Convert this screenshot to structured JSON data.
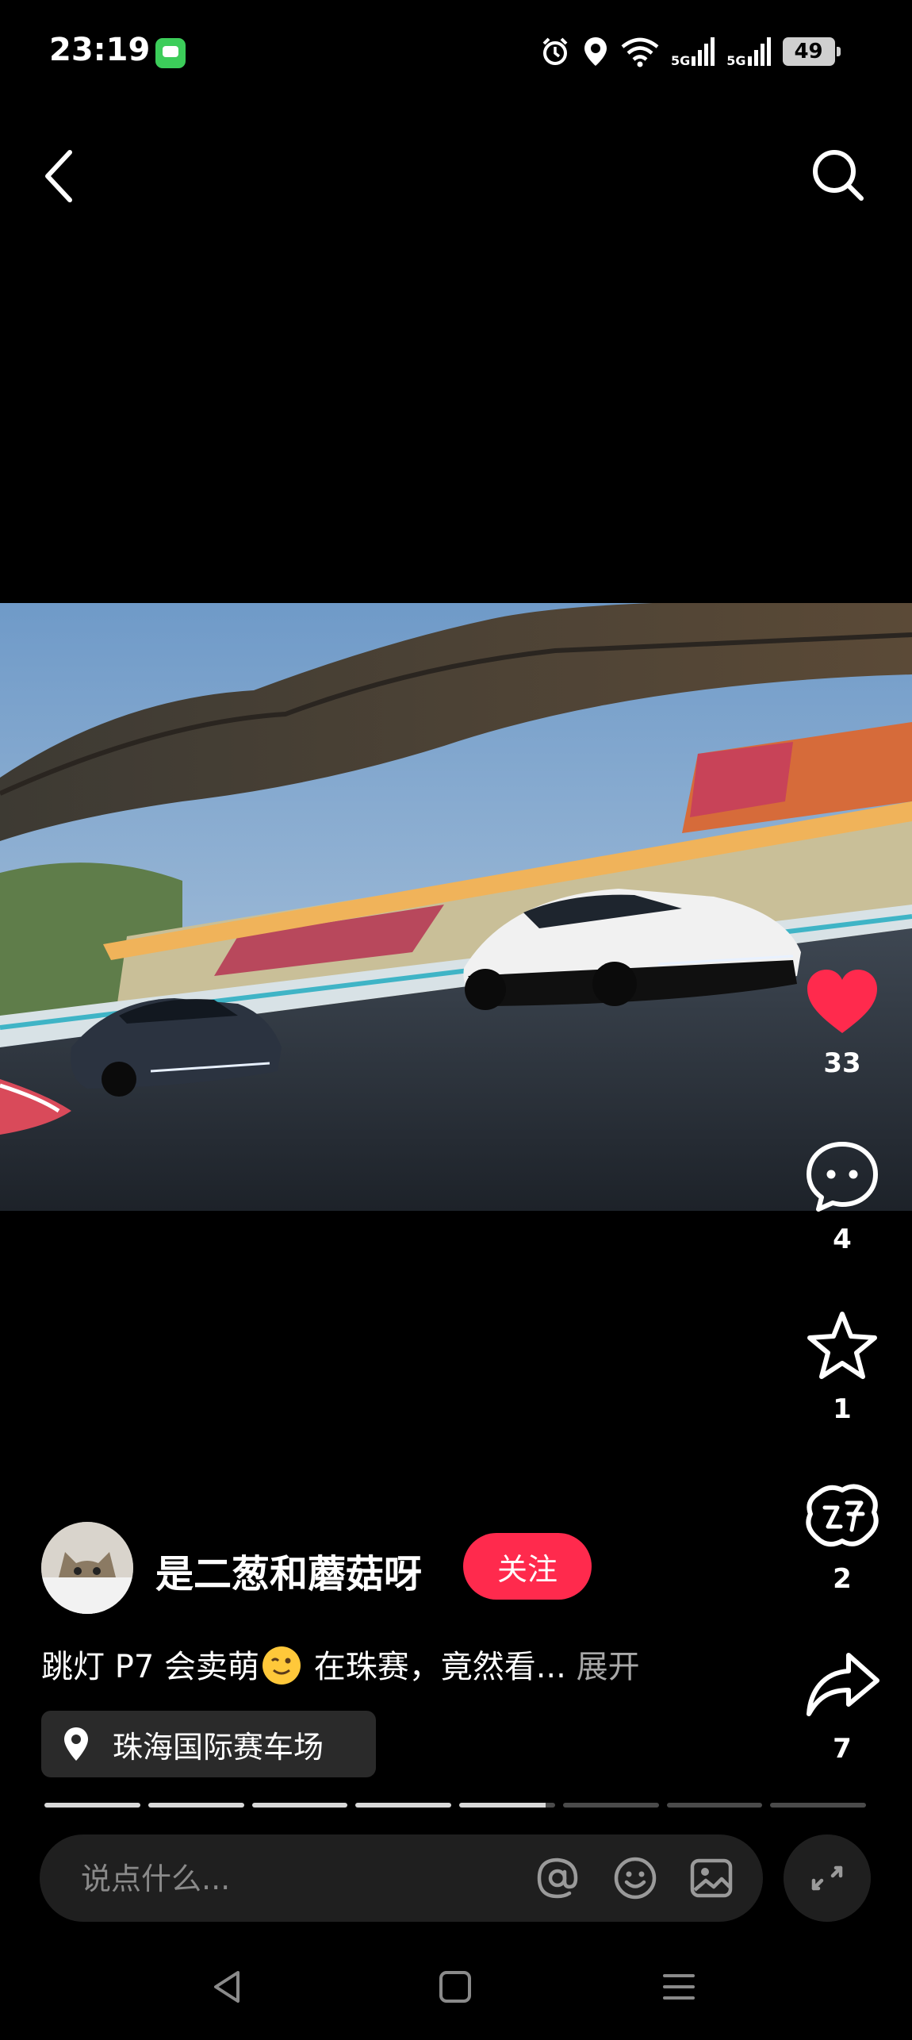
{
  "status_bar": {
    "time": "23:19",
    "signal1": "5G",
    "signal2": "5G",
    "battery": "49"
  },
  "post": {
    "author": {
      "name": "是二葱和蘑菇呀",
      "follow_label": "关注"
    },
    "caption": {
      "text_before_emoji": "跳灯 P7 会卖萌",
      "text_after_emoji": " 在珠赛，竟然看...",
      "more_label": " 展开"
    },
    "location": "珠海国际赛车场",
    "actions": {
      "likes": "33",
      "comments": "4",
      "favorites": "1",
      "gifts": "2",
      "shares": "7"
    },
    "progress": {
      "total_segments": 8,
      "completed_segments": 5,
      "current_segment_fraction": 0.9
    }
  },
  "comment_bar": {
    "placeholder": "说点什么..."
  },
  "colors": {
    "like": "#ff2a4d",
    "follow": "#ff2a4d",
    "background": "#000000"
  }
}
